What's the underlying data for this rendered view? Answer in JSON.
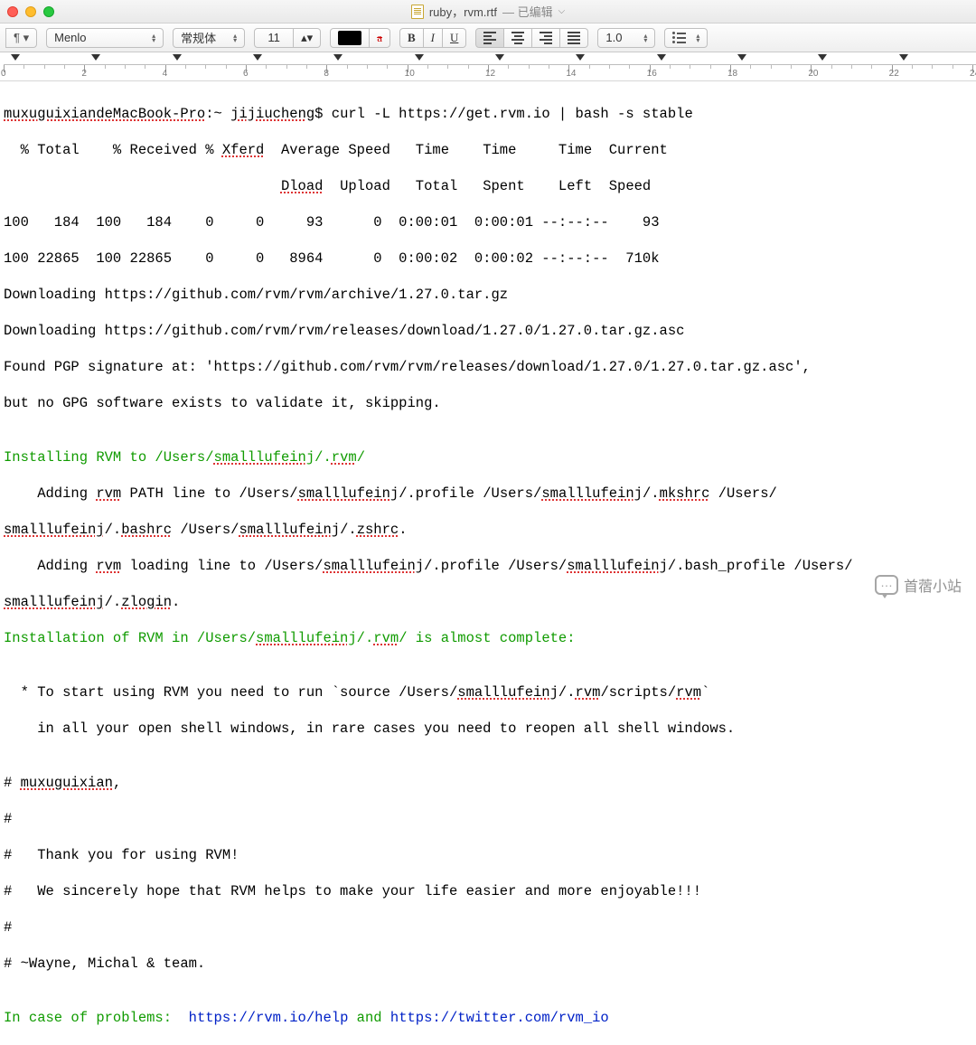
{
  "window": {
    "filename": "ruby，rvm.rtf",
    "edited_suffix": "— 已编辑"
  },
  "toolbar": {
    "font_family": "Menlo",
    "font_style": "常规体",
    "font_size": "11",
    "line_spacing": "1.0",
    "paragraph_symbol": "¶",
    "bold": "B",
    "italic": "I",
    "underline": "U",
    "strike_a": "a"
  },
  "ruler": {
    "labels": [
      "0",
      "2",
      "4",
      "6",
      "8",
      "10",
      "12",
      "14",
      "16",
      "18",
      "20",
      "22",
      "24"
    ],
    "tab_count": 12
  },
  "content": {
    "l1a": "muxuguixiandeMacBook-Pro",
    "l1b": ":~ ",
    "l1c": "jijiucheng",
    "l1d": "$ curl -L https://get.rvm.io | bash -s stable",
    "l2": "  % Total    % Received % Xferd  Average Speed   Time    Time     Time  Current",
    "l2x": "Xferd",
    "l3": "                                 Dload  Upload   Total   Spent    Left  Speed",
    "l3x": "Dload",
    "l4": "100   184  100   184    0     0     93      0  0:00:01  0:00:01 --:--:--    93",
    "l5": "100 22865  100 22865    0     0   8964      0  0:00:02  0:00:02 --:--:--  710k",
    "l6": "Downloading https://github.com/rvm/rvm/archive/1.27.0.tar.gz",
    "l7": "Downloading https://github.com/rvm/rvm/releases/download/1.27.0/1.27.0.tar.gz.asc",
    "l8": "Found PGP signature at: 'https://github.com/rvm/rvm/releases/download/1.27.0/1.27.0.tar.gz.asc',",
    "l9": "but no GPG software exists to validate it, skipping.",
    "l10": "",
    "g1a": "Installing RVM to /Users/",
    "g1b": "smalllufeinj",
    "g1c": "/.",
    "g1d": "rvm",
    "g1e": "/",
    "l12a": "    Adding ",
    "l12b": "rvm",
    "l12c": " PATH line to /Users/",
    "l12d": "smalllufeinj",
    "l12e": "/.profile /Users/",
    "l12f": "smalllufeinj",
    "l12g": "/.",
    "l12h": "mkshrc",
    "l12i": " /Users/",
    "l13a": "smalllufeinj",
    "l13b": "/.",
    "l13c": "bashrc",
    "l13d": " /Users/",
    "l13e": "smalllufeinj",
    "l13f": "/.",
    "l13g": "zshrc",
    "l13h": ".",
    "l14a": "    Adding ",
    "l14b": "rvm",
    "l14c": " loading line to /Users/",
    "l14d": "smalllufeinj",
    "l14e": "/.profile /Users/",
    "l14f": "smalllufeinj",
    "l14g": "/.bash_profile /Users/",
    "l15a": "smalllufeinj",
    "l15b": "/.",
    "l15c": "zlogin",
    "l15d": ".",
    "g2a": "Installation of RVM in /Users/",
    "g2b": "smalllufeinj",
    "g2c": "/.",
    "g2d": "rvm",
    "g2e": "/ is almost complete:",
    "l17": "",
    "l18": "  * To start using RVM you need to run `source /Users/smalllufeinj/.rvm/scripts/rvm`",
    "l18x1": "smalllufeinj",
    "l18x2": "rvm",
    "l18x3": "rvm",
    "l19": "    in all your open shell windows, in rare cases you need to reopen all shell windows.",
    "l20": "",
    "l21": "# muxuguixian,",
    "l21x": "muxuguixian",
    "l22": "#",
    "l23": "#   Thank you for using RVM!",
    "l24": "#   We sincerely hope that RVM helps to make your life easier and more enjoyable!!!",
    "l25": "#",
    "l26": "# ~Wayne, Michal & team.",
    "l27": "",
    "g3a": "In case of problems:  ",
    "g3b": "https://rvm.io/help",
    "g3c": " and ",
    "g3d": "https://twitter.com/rvm_io"
  },
  "watermark": "首蓿小站"
}
